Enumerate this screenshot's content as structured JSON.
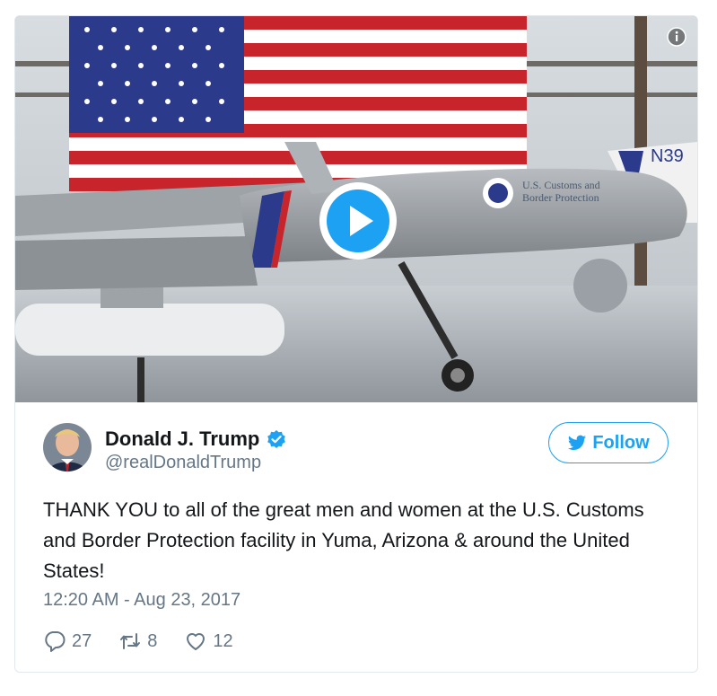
{
  "tweet": {
    "author": {
      "display_name": "Donald J. Trump",
      "handle": "@realDonaldTrump",
      "verified": true
    },
    "follow_label": "Follow",
    "text": "THANK YOU to all of the great men and women at the U.S. Customs and Border Protection facility in Yuma, Arizona & around the United States!",
    "timestamp": "12:20 AM - Aug 23, 2017",
    "actions": {
      "replies": "27",
      "retweets": "8",
      "likes": "12"
    }
  },
  "media": {
    "type": "video",
    "plane_text_line1": "U.S. Customs and",
    "plane_text_line2": "Border Protection",
    "tail_number": "N39"
  },
  "colors": {
    "twitter_blue": "#1da1f2",
    "text_primary": "#14171a",
    "text_secondary": "#657786",
    "border": "#e1e8ed"
  },
  "icons": [
    "info-icon",
    "play-icon",
    "verified-badge-icon",
    "twitter-bird-icon",
    "reply-icon",
    "retweet-icon",
    "like-icon"
  ]
}
